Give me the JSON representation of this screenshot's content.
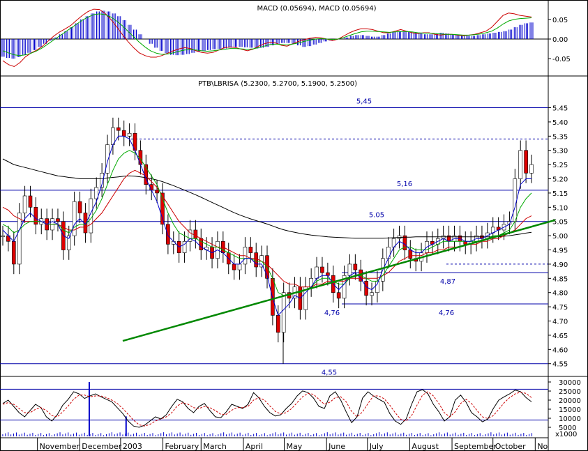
{
  "chart_data": [
    {
      "id": "macd",
      "type": "bar",
      "title": "MACD (0.05694), MACD (0.05694)",
      "ylim": [
        -0.085,
        0.085
      ],
      "yticks": [
        "0.05",
        "0.00",
        "-0.05"
      ],
      "ytick_values": [
        0.05,
        0.0,
        -0.05
      ],
      "series": [
        {
          "kind": "histogram",
          "color": "#0000cc",
          "values": [
            -0.045,
            -0.048,
            -0.05,
            -0.046,
            -0.04,
            -0.035,
            -0.028,
            -0.02,
            -0.012,
            -0.004,
            0.004,
            0.012,
            0.02,
            0.03,
            0.04,
            0.05,
            0.058,
            0.065,
            0.07,
            0.072,
            0.07,
            0.065,
            0.058,
            0.048,
            0.036,
            0.024,
            0.012,
            0.0,
            -0.012,
            -0.022,
            -0.03,
            -0.036,
            -0.04,
            -0.041,
            -0.04,
            -0.038,
            -0.035,
            -0.032,
            -0.03,
            -0.028,
            -0.026,
            -0.025,
            -0.024,
            -0.022,
            -0.02,
            -0.02,
            -0.021,
            -0.022,
            -0.024,
            -0.022,
            -0.02,
            -0.016,
            -0.012,
            -0.01,
            -0.01,
            -0.012,
            -0.016,
            -0.02,
            -0.018,
            -0.014,
            -0.01,
            -0.006,
            -0.004,
            -0.002,
            0.0,
            0.004,
            0.008,
            0.01,
            0.01,
            0.008,
            0.006,
            0.006,
            0.01,
            0.014,
            0.018,
            0.02,
            0.02,
            0.018,
            0.016,
            0.014,
            0.012,
            0.012,
            0.014,
            0.016,
            0.014,
            0.012,
            0.01,
            0.008,
            0.008,
            0.008,
            0.01,
            0.012,
            0.014,
            0.016,
            0.018,
            0.02,
            0.024,
            0.03,
            0.036,
            0.04,
            0.042
          ]
        },
        {
          "kind": "line",
          "color": "#cc0000",
          "values": [
            -0.055,
            -0.065,
            -0.07,
            -0.06,
            -0.045,
            -0.035,
            -0.028,
            -0.018,
            -0.005,
            0.008,
            0.018,
            0.026,
            0.035,
            0.048,
            0.06,
            0.07,
            0.076,
            0.075,
            0.065,
            0.05,
            0.032,
            0.012,
            -0.006,
            -0.022,
            -0.035,
            -0.042,
            -0.046,
            -0.046,
            -0.042,
            -0.036,
            -0.03,
            -0.025,
            -0.022,
            -0.024,
            -0.03,
            -0.034,
            -0.036,
            -0.034,
            -0.028,
            -0.022,
            -0.02,
            -0.022,
            -0.026,
            -0.03,
            -0.026,
            -0.018,
            -0.012,
            -0.008,
            -0.01,
            -0.016,
            -0.018,
            -0.012,
            -0.006,
            -0.002,
            0.002,
            0.004,
            0.003,
            0.0,
            -0.004,
            0.0,
            0.008,
            0.016,
            0.022,
            0.026,
            0.026,
            0.024,
            0.02,
            0.016,
            0.016,
            0.02,
            0.024,
            0.02,
            0.016,
            0.014,
            0.016,
            0.016,
            0.012,
            0.01,
            0.012,
            0.012,
            0.01,
            0.008,
            0.01,
            0.012,
            0.016,
            0.02,
            0.03,
            0.045,
            0.06,
            0.066,
            0.064,
            0.06,
            0.058,
            0.056
          ]
        },
        {
          "kind": "line",
          "color": "#00aa00",
          "values": [
            -0.03,
            -0.035,
            -0.04,
            -0.042,
            -0.04,
            -0.036,
            -0.03,
            -0.022,
            -0.012,
            -0.002,
            0.008,
            0.018,
            0.028,
            0.038,
            0.048,
            0.056,
            0.062,
            0.064,
            0.062,
            0.056,
            0.046,
            0.034,
            0.02,
            0.006,
            -0.008,
            -0.02,
            -0.03,
            -0.036,
            -0.039,
            -0.038,
            -0.035,
            -0.031,
            -0.028,
            -0.027,
            -0.028,
            -0.03,
            -0.031,
            -0.03,
            -0.028,
            -0.026,
            -0.024,
            -0.024,
            -0.025,
            -0.026,
            -0.025,
            -0.022,
            -0.018,
            -0.014,
            -0.013,
            -0.014,
            -0.015,
            -0.013,
            -0.01,
            -0.006,
            -0.003,
            0.0,
            0.001,
            0.0,
            -0.001,
            0.0,
            0.004,
            0.009,
            0.014,
            0.018,
            0.02,
            0.02,
            0.019,
            0.018,
            0.017,
            0.018,
            0.019,
            0.019,
            0.018,
            0.016,
            0.015,
            0.015,
            0.014,
            0.013,
            0.012,
            0.012,
            0.011,
            0.01,
            0.01,
            0.011,
            0.013,
            0.016,
            0.02,
            0.028,
            0.038,
            0.046,
            0.05,
            0.052,
            0.053,
            0.054
          ]
        }
      ]
    },
    {
      "id": "price",
      "type": "line",
      "title": "PTB\\LBRISA (5.2300, 5.2700, 5.1900, 5.2500)",
      "ylim": [
        4.515,
        5.515
      ],
      "yticks": [
        "5.45",
        "5.40",
        "5.35",
        "5.30",
        "5.25",
        "5.20",
        "5.15",
        "5.10",
        "5.05",
        "5.00",
        "4.95",
        "4.90",
        "4.85",
        "4.80",
        "4.75",
        "4.70",
        "4.65",
        "4.60",
        "4.55"
      ],
      "ytick_values": [
        5.45,
        5.4,
        5.35,
        5.3,
        5.25,
        5.2,
        5.15,
        5.1,
        5.05,
        5.0,
        4.95,
        4.9,
        4.85,
        4.8,
        4.75,
        4.7,
        4.65,
        4.6,
        4.55
      ],
      "x_months": [
        "November",
        "December",
        "2003",
        "February",
        "March",
        "April",
        "May",
        "June",
        "July",
        "August",
        "September",
        "October",
        "No"
      ],
      "x_month_days": [
        30,
        61,
        91,
        122,
        150,
        181,
        211,
        242,
        272,
        303,
        334,
        364,
        395
      ],
      "x_range_days": [
        0,
        402
      ],
      "close": [
        5.0,
        4.98,
        4.9,
        5.08,
        5.14,
        5.1,
        5.04,
        5.06,
        5.02,
        5.06,
        5.05,
        4.95,
        5.0,
        5.12,
        5.08,
        5.01,
        5.13,
        5.17,
        5.22,
        5.32,
        5.38,
        5.37,
        5.35,
        5.36,
        5.3,
        5.25,
        5.18,
        5.16,
        5.15,
        5.04,
        4.97,
        4.98,
        4.94,
        4.98,
        5.02,
        4.99,
        4.95,
        4.96,
        4.92,
        4.98,
        4.94,
        4.9,
        4.88,
        4.9,
        4.96,
        4.94,
        4.89,
        4.93,
        4.85,
        4.72,
        4.66,
        4.8,
        4.78,
        4.82,
        4.74,
        4.82,
        4.85,
        4.89,
        4.87,
        4.86,
        4.8,
        4.78,
        4.86,
        4.9,
        4.88,
        4.84,
        4.79,
        4.8,
        4.84,
        4.92,
        4.96,
        4.99,
        5.0,
        4.95,
        4.92,
        4.91,
        4.94,
        4.98,
        4.97,
        4.99,
        5.0,
        4.98,
        5.0,
        4.98,
        4.97,
        4.98,
        5.0,
        4.99,
        5.01,
        5.03,
        5.02,
        5.04,
        5.05,
        5.2,
        5.3,
        5.22,
        5.25
      ],
      "ma_short": [
        5.02,
        5.0,
        4.98,
        5.02,
        5.06,
        5.08,
        5.06,
        5.05,
        5.04,
        5.05,
        5.04,
        5.0,
        4.99,
        5.04,
        5.06,
        5.04,
        5.08,
        5.12,
        5.18,
        5.26,
        5.32,
        5.35,
        5.35,
        5.34,
        5.3,
        5.25,
        5.2,
        5.16,
        5.12,
        5.06,
        5.0,
        4.98,
        4.96,
        4.97,
        4.99,
        4.98,
        4.96,
        4.95,
        4.94,
        4.95,
        4.94,
        4.92,
        4.9,
        4.9,
        4.92,
        4.92,
        4.9,
        4.9,
        4.86,
        4.78,
        4.72,
        4.74,
        4.76,
        4.79,
        4.78,
        4.8,
        4.82,
        4.85,
        4.86,
        4.86,
        4.83,
        4.81,
        4.83,
        4.86,
        4.87,
        4.85,
        4.82,
        4.81,
        4.83,
        4.88,
        4.92,
        4.96,
        4.98,
        4.97,
        4.95,
        4.94,
        4.94,
        4.96,
        4.97,
        4.98,
        4.99,
        4.98,
        4.99,
        4.99,
        4.98,
        4.98,
        4.99,
        4.99,
        5.0,
        5.01,
        5.02,
        5.03,
        5.04,
        5.1,
        5.18,
        5.2,
        5.2
      ],
      "ma_medium": [
        5.04,
        5.03,
        5.01,
        5.02,
        5.04,
        5.05,
        5.05,
        5.05,
        5.04,
        5.04,
        5.04,
        5.02,
        5.01,
        5.03,
        5.04,
        5.04,
        5.06,
        5.09,
        5.13,
        5.18,
        5.23,
        5.27,
        5.29,
        5.3,
        5.29,
        5.27,
        5.24,
        5.21,
        5.18,
        5.13,
        5.08,
        5.04,
        5.01,
        5.0,
        4.99,
        4.99,
        4.98,
        4.97,
        4.96,
        4.96,
        4.95,
        4.94,
        4.93,
        4.92,
        4.92,
        4.92,
        4.91,
        4.91,
        4.89,
        4.85,
        4.8,
        4.79,
        4.79,
        4.8,
        4.8,
        4.81,
        4.82,
        4.84,
        4.85,
        4.85,
        4.84,
        4.83,
        4.83,
        4.85,
        4.86,
        4.86,
        4.85,
        4.84,
        4.84,
        4.86,
        4.89,
        4.92,
        4.95,
        4.96,
        4.96,
        4.95,
        4.95,
        4.95,
        4.96,
        4.97,
        4.98,
        4.98,
        4.98,
        4.98,
        4.98,
        4.98,
        4.98,
        4.98,
        4.99,
        5.0,
        5.0,
        5.01,
        5.02,
        5.05,
        5.1,
        5.13,
        5.15
      ],
      "ma_long": [
        5.1,
        5.09,
        5.07,
        5.06,
        5.05,
        5.05,
        5.05,
        5.05,
        5.04,
        5.04,
        5.04,
        5.03,
        5.02,
        5.02,
        5.03,
        5.03,
        5.04,
        5.06,
        5.08,
        5.11,
        5.14,
        5.17,
        5.2,
        5.22,
        5.23,
        5.22,
        5.21,
        5.19,
        5.17,
        5.14,
        5.11,
        5.08,
        5.05,
        5.03,
        5.01,
        5.0,
        4.99,
        4.98,
        4.97,
        4.96,
        4.96,
        4.95,
        4.94,
        4.93,
        4.93,
        4.92,
        4.92,
        4.91,
        4.9,
        4.88,
        4.86,
        4.84,
        4.83,
        4.83,
        4.82,
        4.82,
        4.82,
        4.83,
        4.83,
        4.84,
        4.84,
        4.84,
        4.84,
        4.85,
        4.85,
        4.85,
        4.85,
        4.85,
        4.85,
        4.86,
        4.87,
        4.89,
        4.91,
        4.92,
        4.93,
        4.93,
        4.93,
        4.94,
        4.94,
        4.95,
        4.95,
        4.96,
        4.96,
        4.96,
        4.97,
        4.97,
        4.97,
        4.98,
        4.98,
        4.99,
        4.99,
        5.0,
        5.01,
        5.02,
        5.04,
        5.06,
        5.07
      ],
      "ma_200": [
        5.27,
        5.26,
        5.25,
        5.245,
        5.24,
        5.235,
        5.23,
        5.225,
        5.22,
        5.215,
        5.21,
        5.208,
        5.205,
        5.203,
        5.2,
        5.2,
        5.2,
        5.2,
        5.201,
        5.203,
        5.205,
        5.207,
        5.209,
        5.21,
        5.209,
        5.207,
        5.204,
        5.2,
        5.196,
        5.19,
        5.183,
        5.176,
        5.168,
        5.16,
        5.152,
        5.144,
        5.135,
        5.126,
        5.117,
        5.108,
        5.099,
        5.09,
        5.081,
        5.073,
        5.066,
        5.059,
        5.053,
        5.047,
        5.041,
        5.034,
        5.027,
        5.021,
        5.016,
        5.012,
        5.008,
        5.005,
        5.002,
        5.0,
        4.998,
        4.996,
        4.995,
        4.994,
        4.993,
        4.992,
        4.991,
        4.991,
        4.991,
        4.991,
        4.991,
        4.991,
        4.992,
        4.993,
        4.994,
        4.995,
        4.995,
        4.996,
        4.996,
        4.996,
        4.996,
        4.996,
        4.996,
        4.996,
        4.996,
        4.996,
        4.996,
        4.996,
        4.996,
        4.996,
        4.996,
        4.996,
        4.996,
        4.998,
        5.0,
        5.003,
        5.006,
        5.009,
        5.012
      ],
      "levels": [
        {
          "value": 5.45,
          "label": "5,45",
          "style": "solid"
        },
        {
          "value": 5.34,
          "label": "",
          "style": "dashed"
        },
        {
          "value": 5.16,
          "label": "5,16",
          "style": "solid"
        },
        {
          "value": 5.05,
          "label": "5.05",
          "style": "solid"
        },
        {
          "value": 4.9,
          "label": "",
          "style": "dashed"
        },
        {
          "value": 4.87,
          "label": "4,87",
          "style": "solid"
        },
        {
          "value": 4.76,
          "label": "4,76",
          "style": "solid"
        },
        {
          "value": 4.55,
          "label": "4,55",
          "style": "solid"
        }
      ],
      "extra_labels": [
        {
          "text": "4,76",
          "value": 4.76
        }
      ],
      "trendline": {
        "color": "#008800",
        "from": {
          "day": 186,
          "value": 4.63
        },
        "to": {
          "day": 402,
          "value": 5.055
        }
      }
    },
    {
      "id": "oscillator_volume",
      "type": "bar",
      "title": "",
      "volume_ylim": [
        0,
        30000
      ],
      "yticks": [
        "30000",
        "25000",
        "20000",
        "15000",
        "10000",
        "5000",
        "x1000"
      ],
      "ytick_values": [
        30000,
        25000,
        20000,
        15000,
        10000,
        5000,
        null
      ],
      "levels": [
        26000,
        9000
      ],
      "volume_spikes": [
        {
          "day": 45,
          "value": 30000
        },
        {
          "day": 72,
          "value": 11000
        }
      ],
      "stoch_k": [
        0.62,
        0.7,
        0.55,
        0.4,
        0.3,
        0.45,
        0.6,
        0.52,
        0.3,
        0.2,
        0.35,
        0.58,
        0.72,
        0.9,
        0.85,
        0.74,
        0.8,
        0.85,
        0.78,
        0.72,
        0.66,
        0.52,
        0.38,
        0.2,
        0.08,
        0.05,
        0.1,
        0.2,
        0.3,
        0.25,
        0.35,
        0.55,
        0.72,
        0.66,
        0.5,
        0.4,
        0.55,
        0.62,
        0.45,
        0.3,
        0.28,
        0.42,
        0.6,
        0.55,
        0.5,
        0.6,
        0.88,
        0.75,
        0.55,
        0.4,
        0.32,
        0.35,
        0.5,
        0.62,
        0.8,
        0.92,
        0.88,
        0.75,
        0.55,
        0.5,
        0.8,
        0.9,
        0.7,
        0.42,
        0.16,
        0.3,
        0.75,
        0.9,
        0.8,
        0.72,
        0.65,
        0.38,
        0.2,
        0.12,
        0.25,
        0.6,
        0.9,
        0.95,
        0.85,
        0.6,
        0.42,
        0.2,
        0.3,
        0.7,
        0.82,
        0.65,
        0.4,
        0.3,
        0.18,
        0.25,
        0.5,
        0.7,
        0.78,
        0.85,
        0.94,
        0.9,
        0.76,
        0.66
      ],
      "stoch_d": [
        0.6,
        0.64,
        0.6,
        0.5,
        0.4,
        0.4,
        0.48,
        0.52,
        0.45,
        0.33,
        0.3,
        0.42,
        0.56,
        0.72,
        0.82,
        0.82,
        0.78,
        0.8,
        0.8,
        0.76,
        0.7,
        0.62,
        0.5,
        0.36,
        0.22,
        0.11,
        0.08,
        0.12,
        0.2,
        0.25,
        0.3,
        0.4,
        0.56,
        0.64,
        0.6,
        0.52,
        0.5,
        0.55,
        0.52,
        0.45,
        0.36,
        0.36,
        0.46,
        0.52,
        0.52,
        0.55,
        0.7,
        0.76,
        0.7,
        0.56,
        0.43,
        0.37,
        0.4,
        0.5,
        0.64,
        0.78,
        0.86,
        0.84,
        0.72,
        0.6,
        0.65,
        0.76,
        0.78,
        0.66,
        0.43,
        0.3,
        0.42,
        0.62,
        0.8,
        0.8,
        0.73,
        0.58,
        0.4,
        0.24,
        0.2,
        0.33,
        0.58,
        0.82,
        0.9,
        0.8,
        0.62,
        0.4,
        0.3,
        0.42,
        0.62,
        0.72,
        0.62,
        0.45,
        0.3,
        0.26,
        0.33,
        0.48,
        0.64,
        0.76,
        0.85,
        0.89,
        0.86,
        0.76
      ]
    }
  ],
  "colors": {
    "blue": "#0000cc",
    "red": "#cc0000",
    "green": "#00aa00",
    "black": "#000000",
    "trend": "#008800",
    "level": "#0000aa"
  }
}
